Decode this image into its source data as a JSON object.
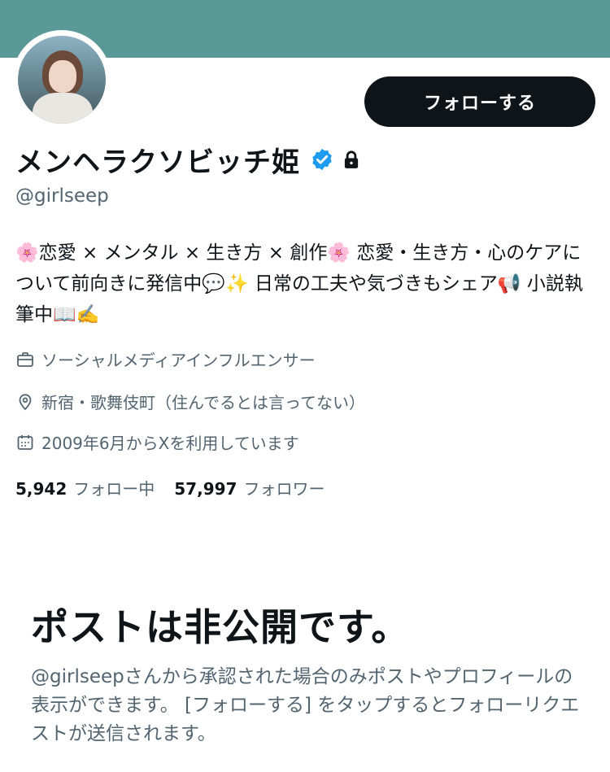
{
  "profile": {
    "display_name": "メンヘラクソビッチ姫",
    "handle": "@girlseep",
    "bio": "🌸恋愛 × メンタル × 生き方 × 創作🌸 恋愛・生き方・心のケアについて前向きに発信中💬✨ 日常の工夫や気づきもシェア📢 小説執筆中📖✍️",
    "category": "ソーシャルメディアインフルエンサー",
    "location": "新宿・歌舞伎町（住んでるとは言ってない）",
    "joined": "2009年6月からXを利用しています",
    "following_count": "5,942",
    "following_label": "フォロー中",
    "followers_count": "57,997",
    "followers_label": "フォロワー"
  },
  "actions": {
    "follow_label": "フォローする"
  },
  "private_notice": {
    "title": "ポストは非公開です。",
    "description": "@girlseepさんから承認された場合のみポストやプロフィールの表示ができます。 [フォローする] をタップするとフォローリクエストが送信されます。"
  },
  "icons": {
    "verified": "verified-badge-icon",
    "lock": "lock-icon",
    "category": "briefcase-icon",
    "location": "location-pin-icon",
    "joined": "calendar-icon"
  },
  "colors": {
    "banner": "#5b9999",
    "verified": "#1d9bf0",
    "button_bg": "#0f1419",
    "secondary_text": "#536471"
  }
}
